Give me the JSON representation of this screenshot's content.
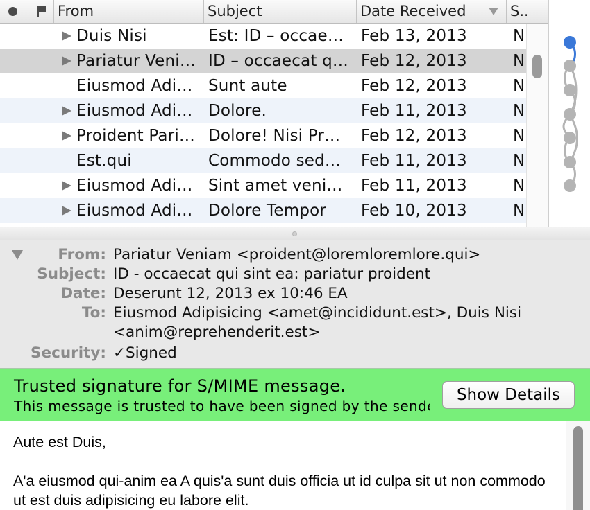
{
  "list": {
    "columns": {
      "from": "From",
      "subject": "Subject",
      "date": "Date Received",
      "size": "S..."
    },
    "rows": [
      {
        "replied": true,
        "thread": true,
        "from": "Duis Nisi",
        "subject": "Est: ID – occae…",
        "date": "Feb 13, 2013",
        "size": "N"
      },
      {
        "replied": true,
        "thread": true,
        "from": "Pariatur Veniam",
        "subject": "ID – occaecat q…",
        "date": "Feb 12, 2013",
        "size": "N"
      },
      {
        "replied": false,
        "thread": false,
        "from": "Eiusmod Adi…",
        "subject": "Sunt aute",
        "date": "Feb 12, 2013",
        "size": "N"
      },
      {
        "replied": false,
        "thread": true,
        "from": "Eiusmod Adi…",
        "subject": "Dolore.",
        "date": "Feb 11, 2013",
        "size": "N"
      },
      {
        "replied": true,
        "thread": true,
        "from": "Proident Pari…",
        "subject": "Dolore! Nisi Pr…",
        "date": "Feb 12, 2013",
        "size": "N"
      },
      {
        "replied": false,
        "thread": false,
        "from": "Est.qui",
        "subject": "Commodo sed…",
        "date": "Feb 11, 2013",
        "size": "N"
      },
      {
        "replied": false,
        "thread": true,
        "from": "Eiusmod Adi…",
        "subject": "Sint amet veniam",
        "date": "Feb 11, 2013",
        "size": "N"
      },
      {
        "replied": false,
        "thread": true,
        "from": "Eiusmod Adi…",
        "subject": "Dolore Tempor",
        "date": "Feb 10, 2013",
        "size": "N"
      }
    ]
  },
  "header": {
    "from_label": "From:",
    "from_value": "Pariatur Veniam <proident@loremloremlore.qui>",
    "subject_label": "Subject:",
    "subject_value": "ID - occaecat qui sint ea: pariatur proident",
    "date_label": "Date:",
    "date_value": "Deserunt 12, 2013 ex 10:46 EA",
    "to_label": "To:",
    "to_value_line1": "Eiusmod Adipisicing <amet@incididunt.est>, Duis Nisi",
    "to_value_line2": "<anim@reprehenderit.est>",
    "security_label": "Security:",
    "security_value": "✓Signed"
  },
  "banner": {
    "title": "Trusted signature for S/MIME message.",
    "subtitle": "This message is trusted to have been signed by the sender.",
    "button_label": "Show Details",
    "color": "#78ef7a"
  },
  "body": {
    "greeting": "Aute est Duis,",
    "paragraph": "A'a eiusmod qui-anim ea A quis'a sunt duis officia ut id culpa sit ut non commodo ut est duis adipisicing eu labore elit."
  },
  "colors": {
    "thread_active": "#3a78d8",
    "thread_inactive": "#b4b4b4"
  }
}
